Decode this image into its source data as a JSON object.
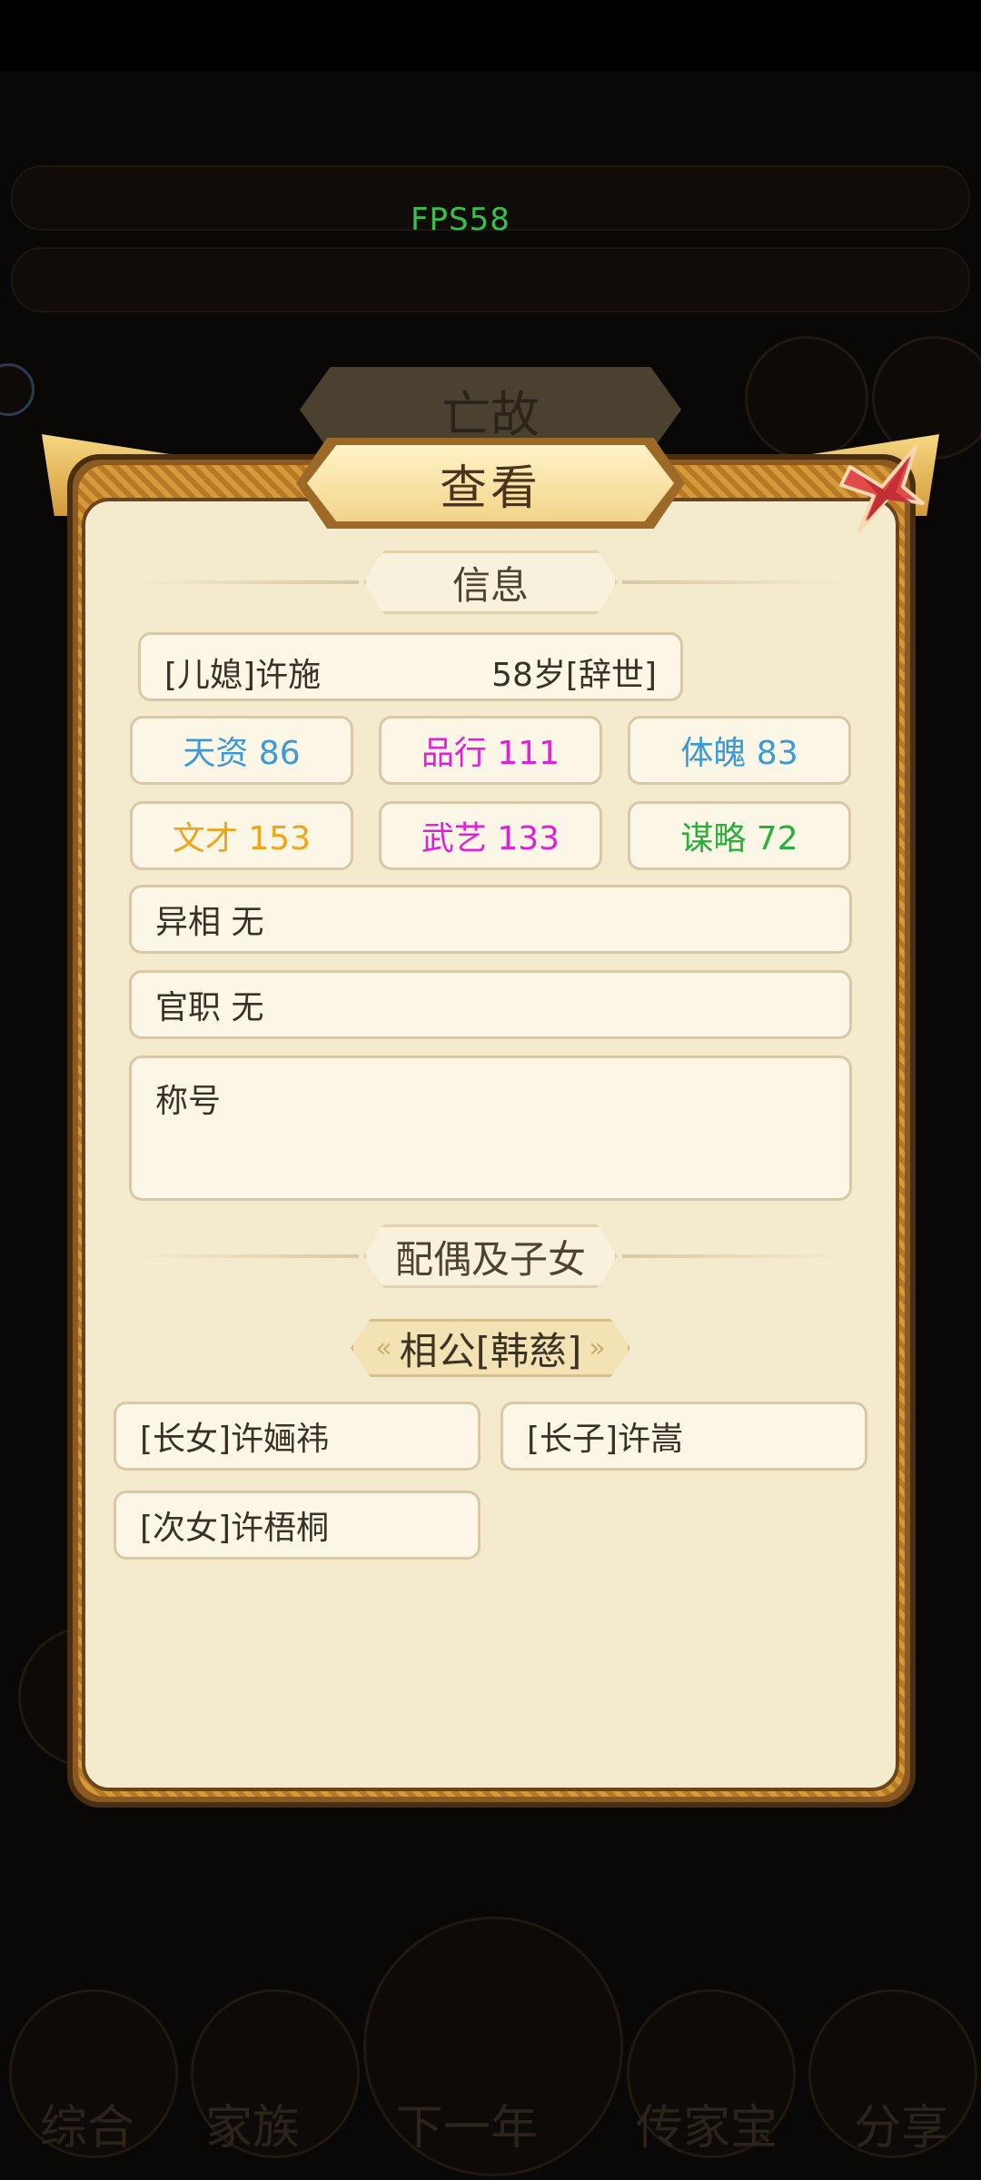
{
  "fps": "FPS58",
  "background": {
    "tab_title": "亡故",
    "nav_labels": [
      "综合",
      "家族",
      "下一年",
      "传家宝",
      "分享"
    ]
  },
  "dialog": {
    "title": "查看",
    "info_header": "信息",
    "person": {
      "name": "[儿媳]许施",
      "age_status": "58岁[辞世]"
    },
    "stats": [
      {
        "label": "天资 86",
        "color": "#3a9ad8"
      },
      {
        "label": "品行 111",
        "color": "#e21fd9"
      },
      {
        "label": "体魄 83",
        "color": "#3a9ad8"
      },
      {
        "label": "文才 153",
        "color": "#f0a417"
      },
      {
        "label": "武艺 133",
        "color": "#e21fd9"
      },
      {
        "label": "谋略 72",
        "color": "#27b13a"
      }
    ],
    "features": "异相 无",
    "official": "官职 无",
    "title_label": "称号",
    "family_header": "配偶及子女",
    "spouse": "相公[韩慈]",
    "children": [
      "[长女]许婳祎",
      "[长子]许嵩",
      "[次女]许梧桐"
    ]
  }
}
